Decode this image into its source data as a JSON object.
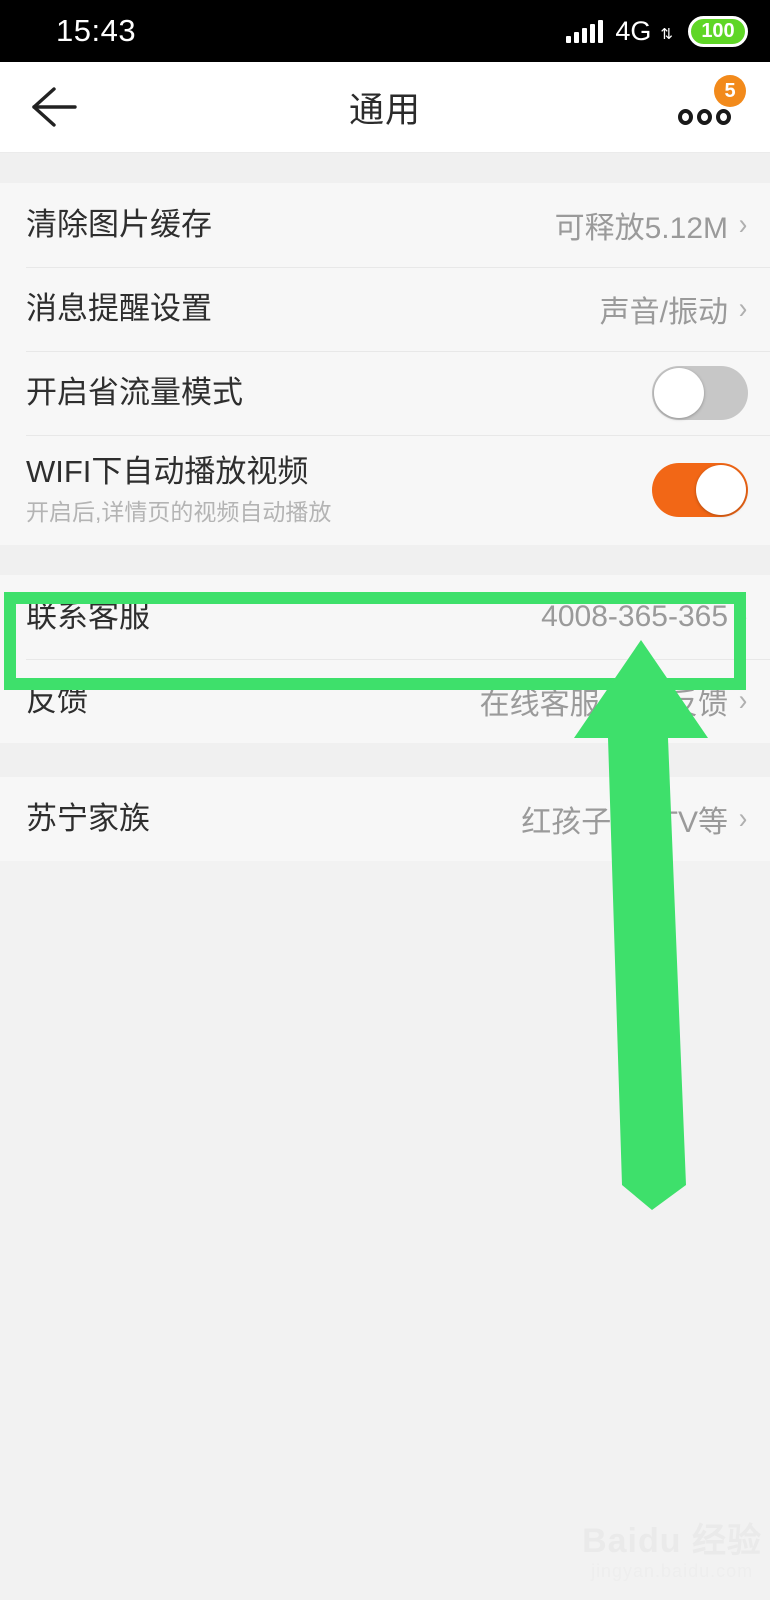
{
  "status_bar": {
    "time": "15:43",
    "network_type": "4G",
    "network_arrows": "⇅",
    "battery_level": "100",
    "signal_icon": "signal-bars-icon",
    "battery_color": "#5fd626"
  },
  "nav_bar": {
    "back_icon": "back-arrow-icon",
    "title": "通用",
    "more_icon": "more-options-icon",
    "badge_count": "5",
    "badge_color": "#f28a1b"
  },
  "sections": [
    {
      "rows": [
        {
          "title": "清除图片缓存",
          "value": "可释放5.12M",
          "accessory": "chevron",
          "name": "row-clear-image-cache"
        },
        {
          "title": "消息提醒设置",
          "value": "声音/振动",
          "accessory": "chevron",
          "name": "row-message-alert-settings"
        },
        {
          "title": "开启省流量模式",
          "value": "",
          "accessory": "toggle-off",
          "name": "row-data-saver-mode"
        },
        {
          "title": "WIFI下自动播放视频",
          "subtitle": "开启后,详情页的视频自动播放",
          "value": "",
          "accessory": "toggle-on",
          "name": "row-wifi-autoplay-video"
        }
      ]
    },
    {
      "rows": [
        {
          "title": "联系客服",
          "value": "4008-365-365",
          "accessory": "chevron",
          "name": "row-contact-customer-service",
          "highlighted": true
        },
        {
          "title": "反馈",
          "value": "在线客服/意见反馈",
          "accessory": "chevron",
          "name": "row-feedback"
        }
      ]
    },
    {
      "rows": [
        {
          "title": "苏宁家族",
          "value": "红孩子/PPTV等",
          "accessory": "chevron",
          "name": "row-suning-family"
        }
      ]
    }
  ],
  "annotations": {
    "highlight_box_color": "#3ee06b",
    "arrow_color": "#3ee06b",
    "arrow_target": "row-contact-customer-service"
  },
  "watermark": {
    "main": "Baidu 经验",
    "sub": "jingyan.baidu.com"
  },
  "chevron_glyph": "›"
}
